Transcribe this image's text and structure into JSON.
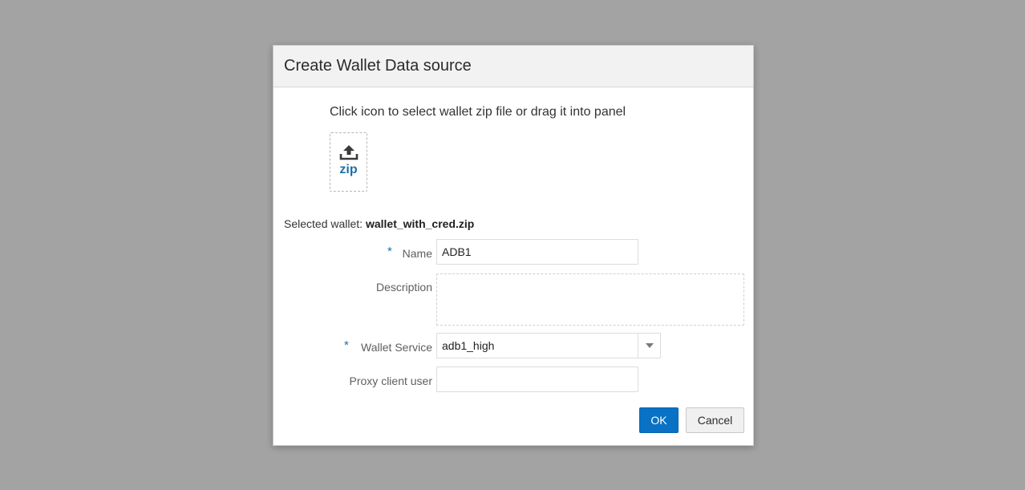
{
  "dialog": {
    "title": "Create Wallet Data source",
    "instruction": "Click icon to select wallet zip file or drag it into panel",
    "dropzone_label": "zip",
    "upload_icon": "upload-icon",
    "selected_wallet_label": "Selected wallet:",
    "selected_wallet_file": "wallet_with_cred.zip"
  },
  "form": {
    "required_marker": "*",
    "name": {
      "label": "Name",
      "value": "ADB1",
      "required": true
    },
    "description": {
      "label": "Description",
      "value": ""
    },
    "wallet_service": {
      "label": "Wallet Service",
      "value": "adb1_high",
      "required": true,
      "arrow_icon": "chevron-down-icon"
    },
    "proxy_client_user": {
      "label": "Proxy client user",
      "value": ""
    }
  },
  "buttons": {
    "ok": "OK",
    "cancel": "Cancel"
  },
  "colors": {
    "backdrop": "#a3a3a3",
    "accent": "#0a72c4",
    "link_blue": "#1f6fa8"
  }
}
